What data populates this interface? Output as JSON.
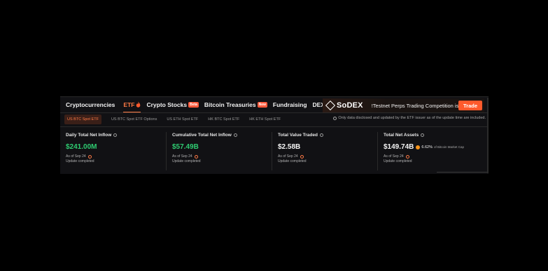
{
  "nav": {
    "items": [
      {
        "label": "Cryptocurrencies",
        "active": false,
        "badge": ""
      },
      {
        "label": "ETF",
        "active": true,
        "badge": "",
        "icon": "flame-icon"
      },
      {
        "label": "Crypto Stocks",
        "active": false,
        "badge": "Beta"
      },
      {
        "label": "Bitcoin Treasuries",
        "active": false,
        "badge": "New"
      },
      {
        "label": "Fundraising",
        "active": false,
        "badge": ""
      },
      {
        "label": "DEX Pool",
        "active": false,
        "badge": ""
      }
    ]
  },
  "promo": {
    "brand": "SoDEX",
    "text": "!Testnet Perps Trading Competition is L",
    "cta": "Trade"
  },
  "subtabs": [
    {
      "label": "US BTC Spot ETF",
      "active": true
    },
    {
      "label": "US BTC Spot ETF Options",
      "active": false
    },
    {
      "label": "US ETH Spot ETF",
      "active": false
    },
    {
      "label": "HK BTC Spot ETF",
      "active": false
    },
    {
      "label": "HK ETH Spot ETF",
      "active": false
    }
  ],
  "note": "Only data disclosed and updated by the ETF issuer as of the update time are included.",
  "stats": [
    {
      "label": "Daily Total Net Inflow",
      "value": "$241.00M",
      "color": "#2ecc71",
      "asof": "As of Sep 24",
      "status": "Update completed"
    },
    {
      "label": "Cumulative Total Net Inflow",
      "value": "$57.49B",
      "color": "#2ecc71",
      "asof": "As of Sep 24",
      "status": "Update completed"
    },
    {
      "label": "Total Value Traded",
      "value": "$2.58B",
      "color": "#f4f4f4",
      "asof": "As of Sep 24",
      "status": "Update completed"
    },
    {
      "label": "Total Net Assets",
      "value": "$149.74B",
      "color": "#f4f4f4",
      "pct": "6.62%",
      "pct_note": "of Bitcoin Market Cap",
      "asof": "As of Sep 24",
      "status": "Update completed"
    }
  ],
  "colors": {
    "accent": "#ff7a45",
    "positive": "#2ecc71",
    "trade_button": "#ff5a2c"
  }
}
